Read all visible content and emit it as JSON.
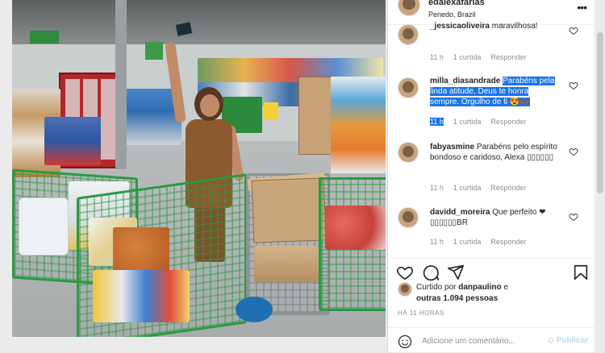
{
  "post": {
    "username": "edalexafarias",
    "location": "Penedo, Brazil",
    "more_icon": "more-options-icon"
  },
  "comments": [
    {
      "username": "_jessicaoliveira",
      "text": "maravilhosa!",
      "time": "11 h",
      "likes": "1 curtida",
      "reply": "Responder"
    },
    {
      "username": "milla_diasandrade",
      "text": "Parabéns pela linda atitude, Deus te honra sempre. Orgulho de ti 😍🙌🏾",
      "time": "11 h",
      "likes": "1 curtida",
      "reply": "Responder"
    },
    {
      "username": "fabyasmine",
      "text": "Parabéns pelo espírito bondoso e caridoso, Alexa ▯▯▯▯▯▯",
      "time": "11 h",
      "likes": "1 curtida",
      "reply": "Responder"
    },
    {
      "username": "davidd_moreira",
      "text": "Que perfeito ❤ ▯▯▯▯▯▯BR",
      "time": "11 h",
      "likes": "1 curtida",
      "reply": "Responder"
    }
  ],
  "likes": {
    "prefix": "Curtido por ",
    "user": "danpaulino",
    "middle": " e",
    "others": "outras 1.094 pessoas"
  },
  "time_ago": "HÁ 11 HORAS",
  "comment_box": {
    "placeholder": "Adicione um comentário...",
    "publish_label": "Publicar"
  },
  "colors": {
    "highlight": "#1a73e8",
    "publish": "#b2dffc",
    "cart_green": "#2a9a43"
  }
}
